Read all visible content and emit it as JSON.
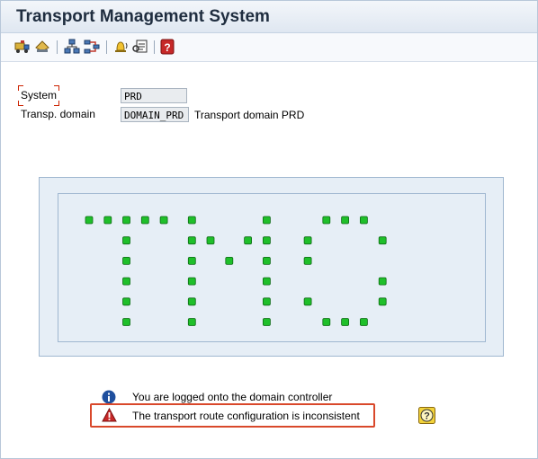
{
  "window": {
    "title": "Transport Management System"
  },
  "toolbar": {
    "buttons": [
      {
        "name": "transport-truck-icon"
      },
      {
        "name": "import-overview-icon"
      },
      {
        "name": "system-overview-icon"
      },
      {
        "name": "transport-routes-icon"
      },
      {
        "name": "alert-monitor-icon"
      },
      {
        "name": "display-details-icon"
      },
      {
        "name": "help-book-icon"
      }
    ]
  },
  "fields": {
    "system": {
      "label": "System",
      "value": "PRD"
    },
    "domain": {
      "label": "Transp. domain",
      "value": "DOMAIN_PRD",
      "description": "Transport domain PRD"
    }
  },
  "logo": {
    "text": "TMS",
    "dot_color": "#1fbf2a"
  },
  "messages": [
    {
      "type": "info",
      "icon": "info-icon",
      "text": "You are logged onto the domain controller"
    },
    {
      "type": "warning",
      "icon": "warning-icon",
      "text": "The transport route configuration is inconsistent"
    }
  ],
  "colors": {
    "highlight": "#d9482b",
    "accent": "#1f2d3f"
  }
}
